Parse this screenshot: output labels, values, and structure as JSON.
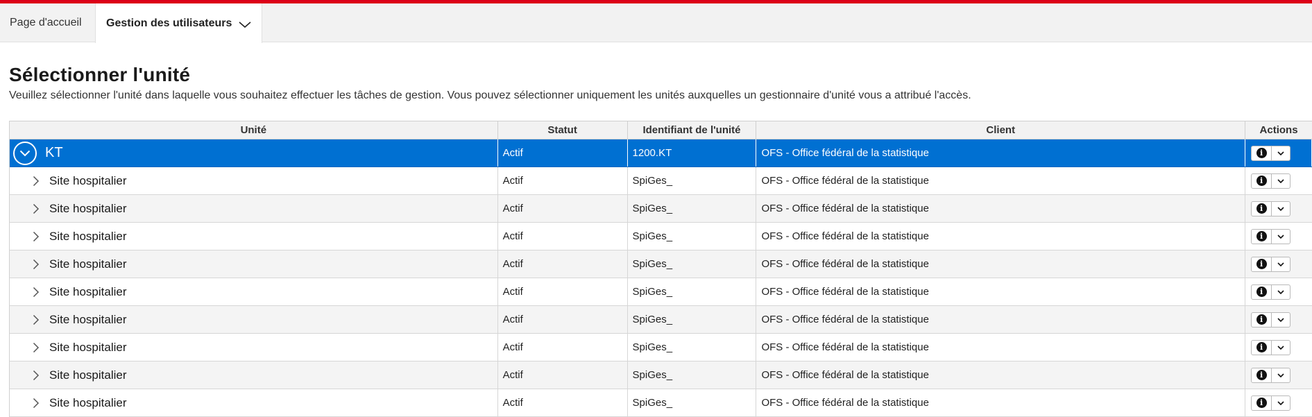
{
  "nav": {
    "home_label": "Page d'accueil",
    "user_mgmt_label": "Gestion des utilisateurs"
  },
  "page": {
    "title": "Sélectionner l'unité",
    "description": "Veuillez sélectionner l'unité dans laquelle vous souhaitez effectuer les tâches de gestion. Vous pouvez sélectionner uniquement les unités auxquelles un gestionnaire d'unité vous a attribué l'accès."
  },
  "table": {
    "headers": [
      "Unité",
      "Statut",
      "Identifiant de l'unité",
      "Client",
      "Actions"
    ],
    "selected_row": {
      "unite": "KT",
      "statut": "Actif",
      "identifiant": "1200.KT",
      "client": "OFS - Office fédéral de la statistique"
    },
    "rows": [
      {
        "unite": "Site hospitalier",
        "statut": "Actif",
        "identifiant": "SpiGes_",
        "client": "OFS - Office fédéral de la statistique"
      },
      {
        "unite": "Site hospitalier",
        "statut": "Actif",
        "identifiant": "SpiGes_",
        "client": "OFS - Office fédéral de la statistique"
      },
      {
        "unite": "Site hospitalier",
        "statut": "Actif",
        "identifiant": "SpiGes_",
        "client": "OFS - Office fédéral de la statistique"
      },
      {
        "unite": "Site hospitalier",
        "statut": "Actif",
        "identifiant": "SpiGes_",
        "client": "OFS - Office fédéral de la statistique"
      },
      {
        "unite": "Site hospitalier",
        "statut": "Actif",
        "identifiant": "SpiGes_",
        "client": "OFS - Office fédéral de la statistique"
      },
      {
        "unite": "Site hospitalier",
        "statut": "Actif",
        "identifiant": "SpiGes_",
        "client": "OFS - Office fédéral de la statistique"
      },
      {
        "unite": "Site hospitalier",
        "statut": "Actif",
        "identifiant": "SpiGes_",
        "client": "OFS - Office fédéral de la statistique"
      },
      {
        "unite": "Site hospitalier",
        "statut": "Actif",
        "identifiant": "SpiGes_",
        "client": "OFS - Office fédéral de la statistique"
      },
      {
        "unite": "Site hospitalier",
        "statut": "Actif",
        "identifiant": "SpiGes_",
        "client": "OFS - Office fédéral de la statistique"
      }
    ]
  },
  "icons": {
    "nav_dropdown": "chevron-down-icon",
    "expand": "chevron-down-circle-icon",
    "row_expand": "chevron-right-icon",
    "info": "info-icon",
    "row_menu": "chevron-down-icon"
  },
  "colors": {
    "brand_red": "#dc0018",
    "selected_row": "#0070d2"
  }
}
